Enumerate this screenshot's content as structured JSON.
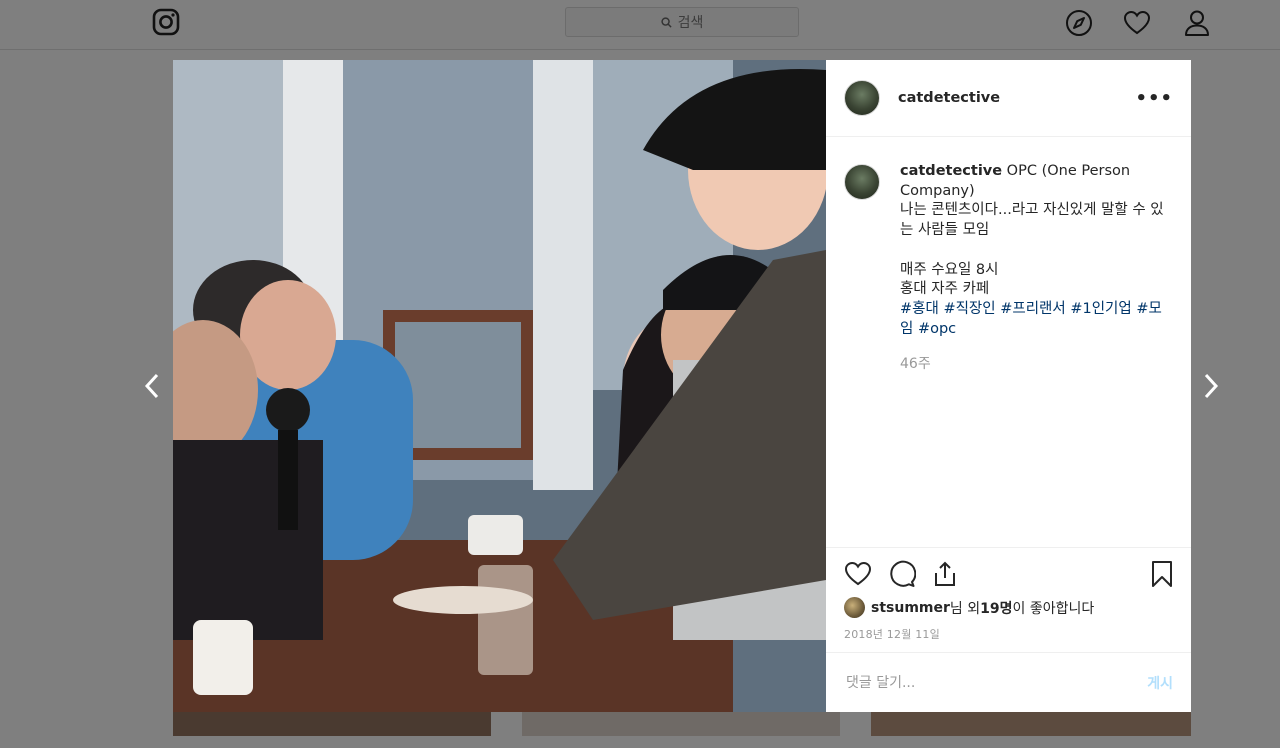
{
  "nav": {
    "search_placeholder": "검색",
    "icons": [
      "instagram-logo",
      "compass-icon",
      "heart-icon",
      "profile-icon"
    ]
  },
  "post": {
    "username": "catdetective",
    "more_label": "•••",
    "caption": {
      "username": "catdetective",
      "text": " OPC (One Person Company)\n나는 콘텐츠이다...라고 자신있게 말할 수 있는 사람들 모임\n\n매주 수요일 8시\n홍대 자주 카페\n",
      "hashtags": "#홍대 #직장인 #프리랜서 #1인기업 #모임 #opc"
    },
    "age": "46주",
    "likes": {
      "user": "stsummer",
      "middle": "님 외 ",
      "count": "19명",
      "suffix": "이 좋아합니다"
    },
    "date": "2018년 12월 11일",
    "comment_placeholder": "댓글 달기...",
    "post_button": "게시"
  },
  "colors": {
    "overlay": "#7f7f7f",
    "hashtag": "#003569",
    "post_button": "#b2dffc",
    "muted": "#999999"
  }
}
